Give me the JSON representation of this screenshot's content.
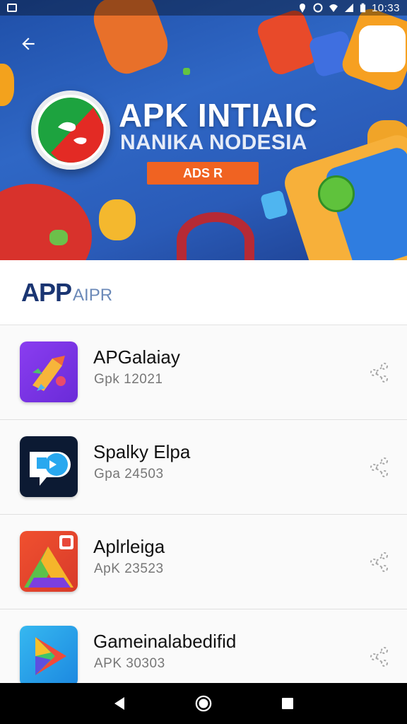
{
  "status_bar": {
    "time": "10:33",
    "icons": [
      "image-icon",
      "location-icon",
      "alarm-icon",
      "wifi-icon",
      "signal-icon",
      "battery-icon"
    ]
  },
  "hero": {
    "title": "APK INTIAIC",
    "subtitle": "NANIKA NODESIA",
    "badge": "ADS R",
    "colors": {
      "background": "#2f67c5",
      "badge": "#f06322"
    }
  },
  "section": {
    "title": "APP",
    "subtitle": "AIPR"
  },
  "apps": [
    {
      "name": "APGalaiay",
      "meta": "Gpk 12021",
      "icon": "app-icon-purple"
    },
    {
      "name": "Spalky Elpa",
      "meta": "Gpa 24503",
      "icon": "app-icon-dark"
    },
    {
      "name": "Aplrleiga",
      "meta": "ApK 23523",
      "icon": "app-icon-red"
    },
    {
      "name": "Gameinalabedifid",
      "meta": "APK 30303",
      "icon": "app-icon-blue"
    }
  ],
  "nav": {
    "icons": [
      "back-triangle-icon",
      "home-circle-icon",
      "recents-square-icon"
    ]
  }
}
